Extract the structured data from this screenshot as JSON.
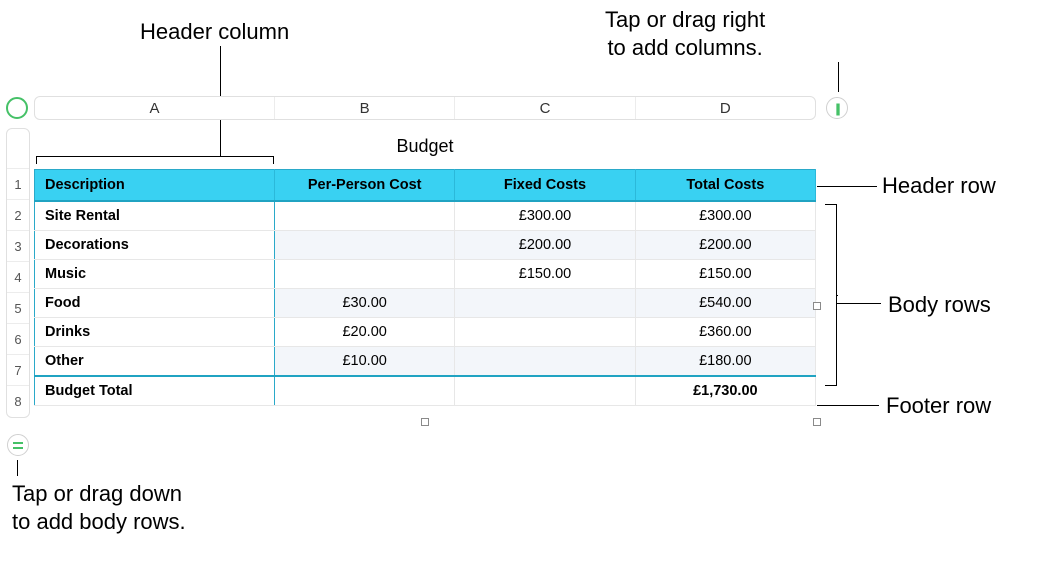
{
  "callouts": {
    "header_column": "Header column",
    "add_columns": "Tap or drag right\nto add columns.",
    "header_row": "Header row",
    "body_rows": "Body rows",
    "footer_row": "Footer row",
    "add_body_rows": "Tap or drag down\nto add body rows."
  },
  "columns": [
    "A",
    "B",
    "C",
    "D"
  ],
  "row_numbers": [
    "1",
    "2",
    "3",
    "4",
    "5",
    "6",
    "7",
    "8"
  ],
  "table": {
    "title": "Budget",
    "headers": [
      "Description",
      "Per-Person Cost",
      "Fixed Costs",
      "Total Costs"
    ],
    "rows": [
      {
        "desc": "Site Rental",
        "per": "",
        "fixed": "£300.00",
        "total": "£300.00"
      },
      {
        "desc": "Decorations",
        "per": "",
        "fixed": "£200.00",
        "total": "£200.00"
      },
      {
        "desc": "Music",
        "per": "",
        "fixed": "£150.00",
        "total": "£150.00"
      },
      {
        "desc": "Food",
        "per": "£30.00",
        "fixed": "",
        "total": "£540.00"
      },
      {
        "desc": "Drinks",
        "per": "£20.00",
        "fixed": "",
        "total": "£360.00"
      },
      {
        "desc": "Other",
        "per": "£10.00",
        "fixed": "",
        "total": "£180.00"
      }
    ],
    "footer": {
      "desc": "Budget Total",
      "per": "",
      "fixed": "",
      "total": "£1,730.00"
    }
  },
  "chart_data": {
    "type": "table",
    "title": "Budget",
    "columns": [
      "Description",
      "Per-Person Cost",
      "Fixed Costs",
      "Total Costs"
    ],
    "rows": [
      [
        "Site Rental",
        null,
        300.0,
        300.0
      ],
      [
        "Decorations",
        null,
        200.0,
        200.0
      ],
      [
        "Music",
        null,
        150.0,
        150.0
      ],
      [
        "Food",
        30.0,
        null,
        540.0
      ],
      [
        "Drinks",
        20.0,
        null,
        360.0
      ],
      [
        "Other",
        10.0,
        null,
        180.0
      ],
      [
        "Budget Total",
        null,
        null,
        1730.0
      ]
    ],
    "currency": "GBP"
  }
}
